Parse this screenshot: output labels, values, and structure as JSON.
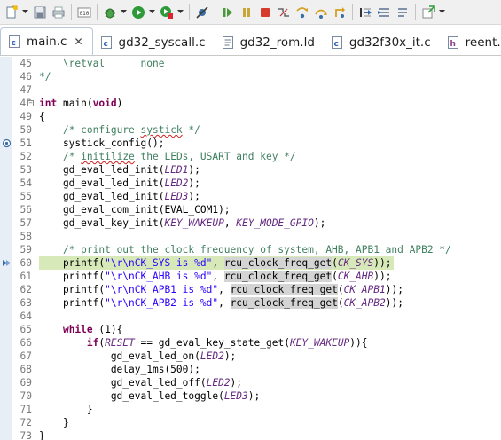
{
  "toolbar": {
    "items": [
      {
        "name": "new-icon"
      },
      {
        "name": "save-icon"
      },
      {
        "name": "print-icon"
      },
      {
        "name": "build-icon"
      },
      {
        "name": "debug-icon"
      },
      {
        "name": "run-icon"
      },
      {
        "name": "external-tools-icon"
      },
      {
        "name": "skip-breakpoints-icon"
      },
      {
        "name": "resume-icon"
      },
      {
        "name": "suspend-icon"
      },
      {
        "name": "terminate-icon"
      },
      {
        "name": "disconnect-icon"
      },
      {
        "name": "step-into-icon"
      },
      {
        "name": "step-over-icon"
      },
      {
        "name": "step-return-icon"
      },
      {
        "name": "instruction-stepping-icon"
      },
      {
        "name": "toggle-mark-icon"
      },
      {
        "name": "next-annotation-icon"
      },
      {
        "name": "open-perspective-icon"
      }
    ]
  },
  "tabs": [
    {
      "label": "main.c",
      "icon": "c-file-icon",
      "active": true,
      "close": "✕"
    },
    {
      "label": "gd32_syscall.c",
      "icon": "c-file-icon",
      "active": false
    },
    {
      "label": "gd32_rom.ld",
      "icon": "text-file-icon",
      "active": false
    },
    {
      "label": "gd32f30x_it.c",
      "icon": "c-file-icon",
      "active": false
    },
    {
      "label": "reent.h",
      "icon": "header-file-icon",
      "active": false
    }
  ],
  "editor": {
    "current_line": 60,
    "lines": [
      {
        "n": "45",
        "text": "    \\retval      none"
      },
      {
        "n": "46",
        "text": "*/"
      },
      {
        "n": "47",
        "text": ""
      },
      {
        "n": "48",
        "text": "int main(void)"
      },
      {
        "n": "49",
        "text": "{"
      },
      {
        "n": "50",
        "text": "    /* configure systick */"
      },
      {
        "n": "51",
        "text": "    systick_config();"
      },
      {
        "n": "52",
        "text": "    /* initilize the LEDs, USART and key */"
      },
      {
        "n": "53",
        "text": "    gd_eval_led_init(LED1);"
      },
      {
        "n": "54",
        "text": "    gd_eval_led_init(LED2);"
      },
      {
        "n": "55",
        "text": "    gd_eval_led_init(LED3);"
      },
      {
        "n": "56",
        "text": "    gd_eval_com_init(EVAL_COM1);"
      },
      {
        "n": "57",
        "text": "    gd_eval_key_init(KEY_WAKEUP, KEY_MODE_GPIO);"
      },
      {
        "n": "58",
        "text": ""
      },
      {
        "n": "59",
        "text": "    /* print out the clock frequency of system, AHB, APB1 and APB2 */"
      },
      {
        "n": "60",
        "text": "    printf(\"\\r\\nCK_SYS is %d\", rcu_clock_freq_get(CK_SYS));"
      },
      {
        "n": "61",
        "text": "    printf(\"\\r\\nCK_AHB is %d\", rcu_clock_freq_get(CK_AHB));"
      },
      {
        "n": "62",
        "text": "    printf(\"\\r\\nCK_APB1 is %d\", rcu_clock_freq_get(CK_APB1));"
      },
      {
        "n": "63",
        "text": "    printf(\"\\r\\nCK_APB2 is %d\", rcu_clock_freq_get(CK_APB2));"
      },
      {
        "n": "64",
        "text": ""
      },
      {
        "n": "65",
        "text": "    while (1){"
      },
      {
        "n": "66",
        "text": "        if(RESET == gd_eval_key_state_get(KEY_WAKEUP)){"
      },
      {
        "n": "67",
        "text": "            gd_eval_led_on(LED2);"
      },
      {
        "n": "68",
        "text": "            delay_1ms(500);"
      },
      {
        "n": "69",
        "text": "            gd_eval_led_off(LED2);"
      },
      {
        "n": "70",
        "text": "            gd_eval_led_toggle(LED3);"
      },
      {
        "n": "71",
        "text": "        }"
      },
      {
        "n": "72",
        "text": "    }"
      },
      {
        "n": "73",
        "text": "}"
      }
    ]
  },
  "colors": {
    "keyword": "#7f0055",
    "comment": "#3f7f5f",
    "string": "#2a00ff",
    "macro": "#642880",
    "current_line_bg": "#d7e9b8",
    "occurrence_bg": "#d4d4d4"
  }
}
